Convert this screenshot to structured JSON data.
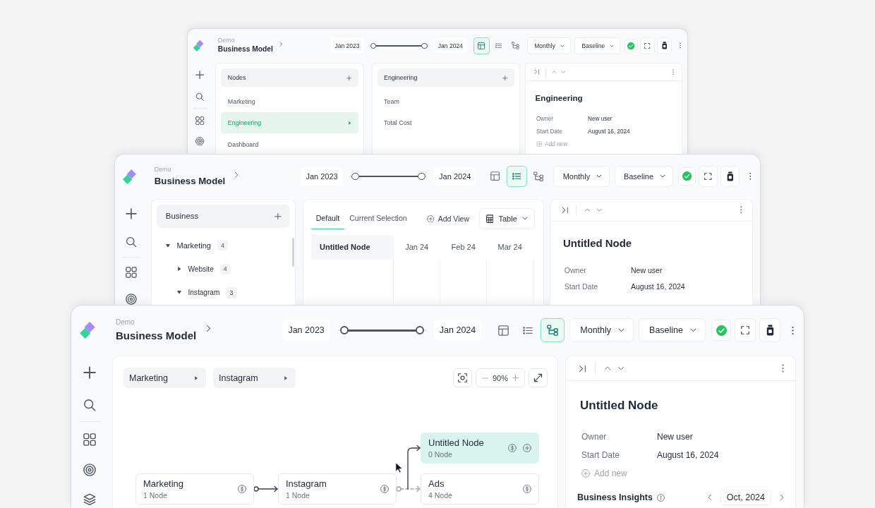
{
  "windows": [
    {
      "kind": "columns",
      "header": {
        "workspace": "Demo",
        "title": "Business Model",
        "range_start": "Jan 2023",
        "range_end": "Jan 2024",
        "range_handles": [
          {
            "level": 0.08
          },
          {
            "level": 0.92
          }
        ],
        "views": [
          {
            "selected": true
          },
          {
            "selected": false
          },
          {
            "selected": false
          }
        ],
        "dropdowns": [
          "Monthly",
          "Baseline"
        ]
      },
      "columns": [
        {
          "title": "Nodes",
          "items": [
            {
              "label": "Marketing",
              "selected": false
            },
            {
              "label": "Engineering",
              "selected": true
            },
            {
              "label": "Dashboard",
              "selected": false
            }
          ]
        },
        {
          "title": "Engineering",
          "items": [
            {
              "label": "Team",
              "selected": false
            },
            {
              "label": "Total Cost",
              "selected": false
            }
          ]
        }
      ],
      "details": {
        "title": "Engineering",
        "properties": [
          {
            "label": "Owner",
            "value": "New user"
          },
          {
            "label": "Start Date",
            "value": "August 16, 2024"
          }
        ],
        "add_label": "Add new"
      }
    },
    {
      "kind": "table",
      "header": {
        "workspace": "Demo",
        "title": "Business Model",
        "range_start": "Jan 2023",
        "range_end": "Jan 2024",
        "range_handles": [
          {
            "level": 0.08
          },
          {
            "level": 0.92
          }
        ],
        "views": [
          {
            "selected": false
          },
          {
            "selected": true
          },
          {
            "selected": false
          }
        ],
        "dropdowns": [
          "Monthly",
          "Baseline"
        ]
      },
      "tree": {
        "title": "Business",
        "items": [
          {
            "label": "Marketing",
            "count": "4",
            "expanded": true,
            "children": [
              {
                "label": "Website",
                "count": "4",
                "expanded": false
              },
              {
                "label": "Instagram",
                "count": "3",
                "expanded": true
              }
            ]
          }
        ]
      },
      "view_tabs": [
        {
          "label": "Default",
          "selected": true
        },
        {
          "label": "Current Selection",
          "selected": false
        }
      ],
      "add_view": "Add View",
      "view_type": "Table",
      "table": {
        "columns": [
          "Untitled Node",
          "Jan 24",
          "Feb 24",
          "Mar 24"
        ]
      },
      "details": {
        "title": "Untitled Node",
        "properties": [
          {
            "label": "Owner",
            "value": "New user"
          },
          {
            "label": "Start Date",
            "value": "August 16, 2024"
          }
        ]
      }
    },
    {
      "kind": "canvas",
      "header": {
        "workspace": "Demo",
        "title": "Business Model",
        "range_start": "Jan 2023",
        "range_end": "Jan 2024",
        "range_handles": [
          {
            "level": 0.08
          },
          {
            "level": 0.92
          }
        ],
        "views": [
          {
            "selected": false
          },
          {
            "selected": false
          },
          {
            "selected": true
          }
        ],
        "dropdowns": [
          "Monthly",
          "Baseline"
        ]
      },
      "breadcrumbs": [
        "Marketing",
        "Instagram"
      ],
      "zoom": "90%",
      "nodes": [
        {
          "title": "Untitled Node",
          "subtitle": "0 Node",
          "selected": true
        },
        {
          "title": "Marketing",
          "subtitle": "1 Node",
          "selected": false
        },
        {
          "title": "Instagram",
          "subtitle": "1 Node",
          "selected": false
        },
        {
          "title": "Ads",
          "subtitle": "4 Node",
          "selected": false
        }
      ],
      "details": {
        "title": "Untitled Node",
        "properties": [
          {
            "label": "Owner",
            "value": "New user"
          },
          {
            "label": "Start Date",
            "value": "August 16, 2024"
          }
        ],
        "add_label": "Add new",
        "insights": {
          "title": "Business Insights",
          "period": "Oct, 2024"
        }
      }
    }
  ]
}
